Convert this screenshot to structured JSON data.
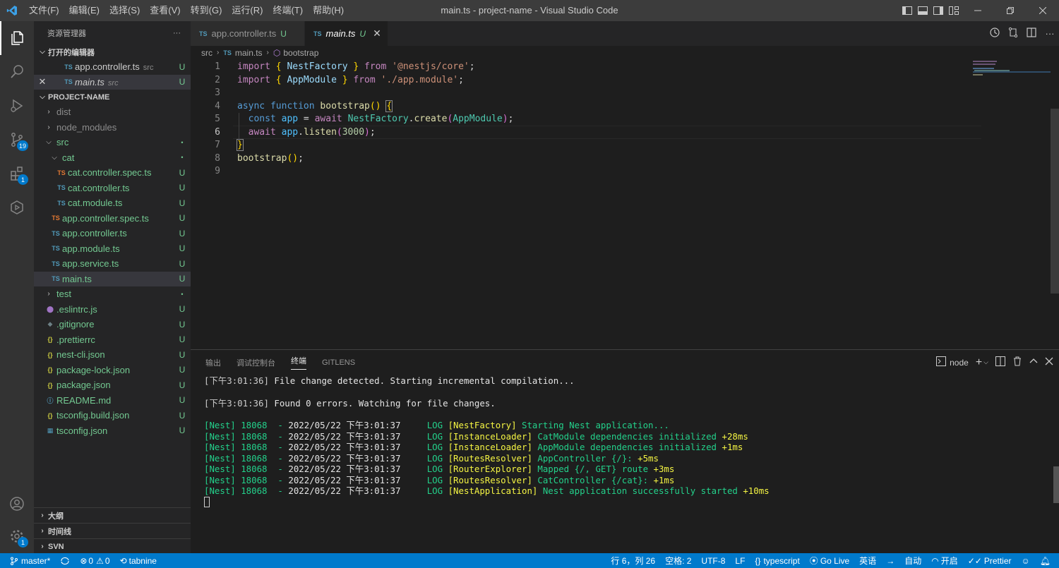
{
  "titlebar": {
    "title": "main.ts - project-name - Visual Studio Code",
    "menu": [
      "文件(F)",
      "编辑(E)",
      "选择(S)",
      "查看(V)",
      "转到(G)",
      "运行(R)",
      "终端(T)",
      "帮助(H)"
    ]
  },
  "colors": {
    "accent": "#007acc",
    "titlebar": "#3c3c3c",
    "activitybar": "#333333",
    "sidebar": "#252526",
    "editor": "#1e1e1e"
  },
  "activity": {
    "scm_badge": "19",
    "ext_badge": "1",
    "settings_badge": "1"
  },
  "sidebar": {
    "title": "资源管理器",
    "more": "···",
    "open_editors_title": "打开的编辑器",
    "open_editors": [
      {
        "icon": "TS",
        "name": "app.controller.ts",
        "desc": "src",
        "status": "U"
      },
      {
        "icon": "TS",
        "name": "main.ts",
        "desc": "src",
        "status": "U"
      }
    ],
    "project_title": "PROJECT-NAME",
    "tree": [
      {
        "name": "dist",
        "status": ""
      },
      {
        "name": "node_modules",
        "status": ""
      },
      {
        "name": "src",
        "status": "•"
      },
      {
        "name": "cat",
        "status": "•"
      },
      {
        "icon": "TS",
        "name": "cat.controller.spec.ts",
        "status": "U"
      },
      {
        "icon": "TS",
        "name": "cat.controller.ts",
        "status": "U"
      },
      {
        "icon": "TS",
        "name": "cat.module.ts",
        "status": "U"
      },
      {
        "icon": "TS",
        "name": "app.controller.spec.ts",
        "status": "U"
      },
      {
        "icon": "TS",
        "name": "app.controller.ts",
        "status": "U"
      },
      {
        "icon": "TS",
        "name": "app.module.ts",
        "status": "U"
      },
      {
        "icon": "TS",
        "name": "app.service.ts",
        "status": "U"
      },
      {
        "icon": "TS",
        "name": "main.ts",
        "status": "U"
      },
      {
        "name": "test",
        "status": "•"
      },
      {
        "icon": "⬤",
        "name": ".eslintrc.js",
        "status": "U"
      },
      {
        "icon": "◆",
        "name": ".gitignore",
        "status": "U"
      },
      {
        "icon": "{}",
        "name": ".prettierrc",
        "status": "U"
      },
      {
        "icon": "{}",
        "name": "nest-cli.json",
        "status": "U"
      },
      {
        "icon": "{}",
        "name": "package-lock.json",
        "status": "U"
      },
      {
        "icon": "{}",
        "name": "package.json",
        "status": "U"
      },
      {
        "icon": "ⓘ",
        "name": "README.md",
        "status": "U"
      },
      {
        "icon": "{}",
        "name": "tsconfig.build.json",
        "status": "U"
      },
      {
        "icon": "▦",
        "name": "tsconfig.json",
        "status": "U"
      }
    ],
    "outline": "大纲",
    "timeline": "时间线",
    "svn": "SVN"
  },
  "editor": {
    "tabs": [
      {
        "icon": "TS",
        "label": "app.controller.ts",
        "status": "U"
      },
      {
        "icon": "TS",
        "label": "main.ts",
        "status": "U",
        "close": "✕"
      }
    ],
    "breadcrumb": [
      "src",
      "main.ts",
      "bootstrap"
    ],
    "line_numbers": [
      "1",
      "2",
      "3",
      "4",
      "5",
      "6",
      "7",
      "8",
      "9"
    ]
  },
  "panel": {
    "tabs": [
      "输出",
      "调试控制台",
      "终端",
      "GITLENS"
    ],
    "terminal_name": "node",
    "lines": [
      {
        "a": "[下午3:01:36] ",
        "b": "File change detected. Starting incremental compilation..."
      },
      {
        "a": "[下午3:01:36] ",
        "b": "Found 0 errors. Watching for file changes."
      },
      {
        "p": "[Nest] 18068  - ",
        "d": "2022/05/22 下午3:01:37",
        "l": "     LOG ",
        "c": "[NestFactory]",
        "m": " Starting Nest application...",
        "t": ""
      },
      {
        "p": "[Nest] 18068  - ",
        "d": "2022/05/22 下午3:01:37",
        "l": "     LOG ",
        "c": "[InstanceLoader]",
        "m": " CatModule dependencies initialized ",
        "t": "+28ms"
      },
      {
        "p": "[Nest] 18068  - ",
        "d": "2022/05/22 下午3:01:37",
        "l": "     LOG ",
        "c": "[InstanceLoader]",
        "m": " AppModule dependencies initialized ",
        "t": "+1ms"
      },
      {
        "p": "[Nest] 18068  - ",
        "d": "2022/05/22 下午3:01:37",
        "l": "     LOG ",
        "c": "[RoutesResolver]",
        "m": " AppController {/}: ",
        "t": "+5ms"
      },
      {
        "p": "[Nest] 18068  - ",
        "d": "2022/05/22 下午3:01:37",
        "l": "     LOG ",
        "c": "[RouterExplorer]",
        "m": " Mapped {/, GET} route ",
        "t": "+3ms"
      },
      {
        "p": "[Nest] 18068  - ",
        "d": "2022/05/22 下午3:01:37",
        "l": "     LOG ",
        "c": "[RoutesResolver]",
        "m": " CatController {/cat}: ",
        "t": "+1ms"
      },
      {
        "p": "[Nest] 18068  - ",
        "d": "2022/05/22 下午3:01:37",
        "l": "     LOG ",
        "c": "[NestApplication]",
        "m": " Nest application successfully started ",
        "t": "+10ms"
      }
    ]
  },
  "status": {
    "branch": "master*",
    "errors": "0",
    "warnings": "0",
    "tabnine": "tabnine",
    "position": "行 6，列 26",
    "spaces": "空格: 2",
    "encoding": "UTF-8",
    "eol": "LF",
    "language": "typescript",
    "golive": "Go Live",
    "input": "英语",
    "auto": "自动",
    "open": "开启",
    "prettier": "Prettier"
  }
}
